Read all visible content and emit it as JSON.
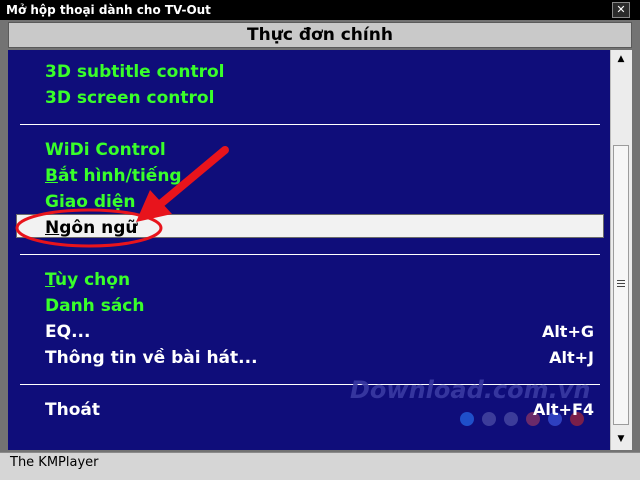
{
  "window": {
    "title": "Mở hộp thoại dành cho TV-Out",
    "close_glyph": "✕"
  },
  "menu": {
    "title": "Thực đơn chính",
    "items": [
      {
        "label": "3D subtitle control"
      },
      {
        "label": "3D screen control"
      },
      {
        "label": "WiDi Control"
      },
      {
        "accel": "B",
        "rest": "ắt hình/tiếng"
      },
      {
        "label": "Giao diện"
      },
      {
        "accel": "N",
        "rest": "gôn ngữ"
      },
      {
        "accel": "T",
        "rest": "ùy chọn"
      },
      {
        "label": "Danh sách"
      },
      {
        "label": "EQ...",
        "shortcut": "Alt+G"
      },
      {
        "label": "Thông tin về bài hát...",
        "shortcut": "Alt+J"
      },
      {
        "label": "Thoát",
        "shortcut": "Alt+F4"
      }
    ]
  },
  "watermark": {
    "text": "Download.com.vn"
  },
  "status": {
    "text": "The KMPlayer"
  },
  "colors": {
    "panel": "#0f0d7a",
    "item_green": "#39ff2a",
    "highlight": "#f2f2f2",
    "annotation_red": "#e8141c"
  }
}
